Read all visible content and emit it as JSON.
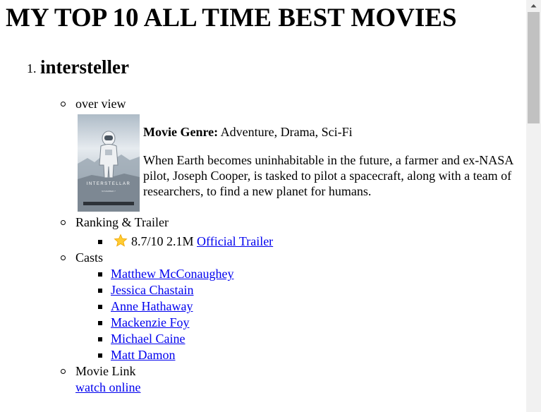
{
  "page": {
    "heading": "MY TOP 10 ALL TIME BEST MOVIES"
  },
  "movies": [
    {
      "number": "1.",
      "title": "intersteller",
      "overview": {
        "label": "over view",
        "poster_icon": "interstellar-poster-image",
        "genre_label": "Movie Genre:",
        "genre_value": " Adventure, Drama, Sci-Fi",
        "description": "When Earth becomes uninhabitable in the future, a farmer and ex-NASA pilot, Joseph Cooper, is tasked to pilot a spacecraft, along with a team of researchers, to find a new planet for humans."
      },
      "ranking": {
        "label": "Ranking & Trailer",
        "star_icon": "star-icon",
        "rating": "8.7/10",
        "votes": "2.1M",
        "trailer_link": "Official Trailer"
      },
      "casts": {
        "label": "Casts",
        "items": [
          "Matthew McConaughey",
          "Jessica Chastain",
          "Anne Hathaway",
          "Mackenzie Foy",
          "Michael Caine",
          "Matt Damon"
        ]
      },
      "movie_link": {
        "label": "Movie Link",
        "link_text": "watch online"
      }
    }
  ],
  "colors": {
    "link": "#0000ee",
    "text": "#000000",
    "scrollbar_track": "#f1f1f1",
    "scrollbar_thumb": "#c1c1c1"
  }
}
